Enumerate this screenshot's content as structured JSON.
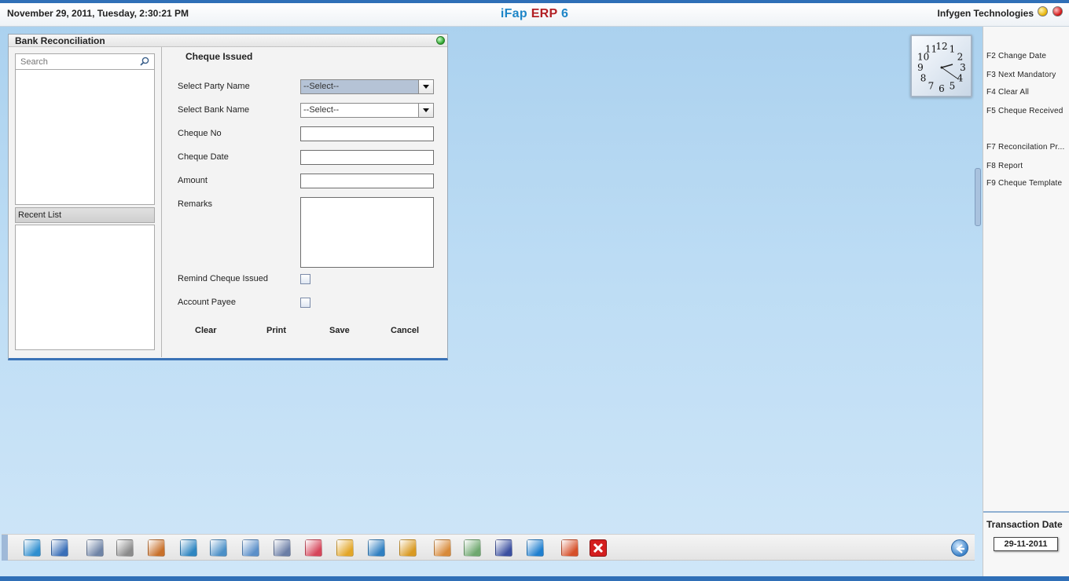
{
  "header": {
    "datetime": "November  29, 2011, Tuesday, 2:30:21 PM",
    "brand_part1": "iFap",
    "brand_part2": "ERP",
    "brand_part3": "6",
    "company": "Infygen Technologies"
  },
  "window": {
    "title": "Bank Reconciliation",
    "search_placeholder": "Search",
    "recent_list_label": "Recent List"
  },
  "form": {
    "title": "Cheque Issued",
    "party_label": "Select Party Name",
    "party_value": "--Select--",
    "bank_label": "Select Bank Name",
    "bank_value": "--Select--",
    "cheque_no_label": "Cheque No",
    "cheque_no_value": "",
    "cheque_date_label": "Cheque Date",
    "cheque_date_value": "",
    "amount_label": "Amount",
    "amount_value": "",
    "remarks_label": "Remarks",
    "remarks_value": "",
    "remind_label": "Remind Cheque Issued",
    "remind_checked": false,
    "payee_label": "Account Payee",
    "payee_checked": false,
    "buttons": {
      "clear": "Clear",
      "print": "Print",
      "save": "Save",
      "cancel": "Cancel"
    }
  },
  "shortcuts": [
    "F2 Change Date",
    "F3 Next Mandatory",
    "F4 Clear All",
    "F5 Cheque Received",
    "F7 Reconcilation Pr...",
    "F8 Report",
    "F9 Cheque Template"
  ],
  "transaction": {
    "label": "Transaction Date",
    "date": "29-11-2011"
  },
  "clock": {
    "numerals": [
      "12",
      "1",
      "2",
      "3",
      "4",
      "5",
      "6",
      "7",
      "8",
      "9",
      "10",
      "11"
    ]
  },
  "taskbar_icons": [
    {
      "name": "inventory-icon",
      "color": "#2f8fd0"
    },
    {
      "name": "user-icon",
      "color": "#3a6fb8"
    },
    {
      "name": "employees-icon",
      "color": "#6f84a6"
    },
    {
      "name": "network-icon",
      "color": "#8b8b8b"
    },
    {
      "name": "books-icon",
      "color": "#c8702a"
    },
    {
      "name": "cart-icon",
      "color": "#2e86c1"
    },
    {
      "name": "transfer-icon",
      "color": "#4a8fc7"
    },
    {
      "name": "window-icon",
      "color": "#5b8fc9"
    },
    {
      "name": "document-icon",
      "color": "#6b7ea6"
    },
    {
      "name": "chart-icon",
      "color": "#d6465a"
    },
    {
      "name": "folder-tree-icon",
      "color": "#e3a628"
    },
    {
      "name": "puzzle-icon",
      "color": "#2f7fc1"
    },
    {
      "name": "box-icon",
      "color": "#d99a22"
    },
    {
      "name": "coins-icon",
      "color": "#d88a3a"
    },
    {
      "name": "spreadsheet-icon",
      "color": "#6fa86f"
    },
    {
      "name": "save-disk-icon",
      "color": "#3b4fa0"
    },
    {
      "name": "settings-icon",
      "color": "#1f7fcf"
    },
    {
      "name": "calendar-icon",
      "color": "#d6502a"
    },
    {
      "name": "exit-icon",
      "color": "#d41f1f"
    }
  ]
}
